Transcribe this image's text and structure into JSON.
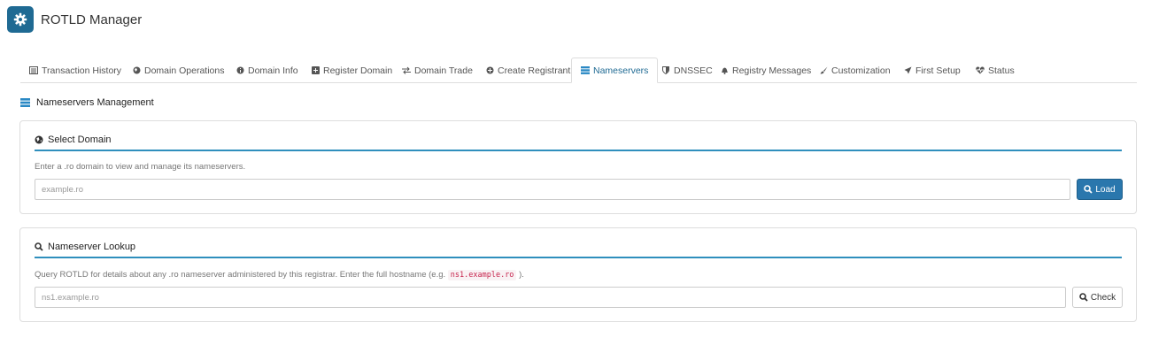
{
  "app": {
    "title": "ROTLD Manager",
    "icon": "gear-icon",
    "accent": "#1f6a93"
  },
  "tabs": [
    {
      "label": "Transaction History",
      "icon": "list-icon"
    },
    {
      "label": "Domain Operations",
      "icon": "globe-icon"
    },
    {
      "label": "Domain Info",
      "icon": "info-icon"
    },
    {
      "label": "Register Domain",
      "icon": "plus-square-icon"
    },
    {
      "label": "Domain Trade",
      "icon": "exchange-icon"
    },
    {
      "label": "Create Registrant",
      "icon": "plus-circle-icon"
    },
    {
      "label": "Nameservers",
      "icon": "server-icon",
      "active": true
    },
    {
      "label": "DNSSEC",
      "icon": "shield-icon"
    },
    {
      "label": "Registry Messages",
      "icon": "bell-icon"
    },
    {
      "label": "Customization",
      "icon": "brush-icon"
    },
    {
      "label": "First Setup",
      "icon": "rocket-icon"
    },
    {
      "label": "Status",
      "icon": "heartbeat-icon"
    }
  ],
  "section": {
    "title": "Nameservers Management",
    "icon": "server-icon"
  },
  "select_domain": {
    "title": "Select Domain",
    "icon": "globe-icon",
    "description": "Enter a .ro domain to view and manage its nameservers.",
    "placeholder": "example.ro",
    "value": "",
    "button_label": "Load",
    "button_icon": "search-icon"
  },
  "ns_lookup": {
    "title": "Nameserver Lookup",
    "icon": "search-icon",
    "description_before": "Query ROTLD for details about any .ro nameserver administered by this registrar. Enter the full hostname (e.g.",
    "description_code": "ns1.example.ro",
    "description_after": ").",
    "placeholder": "ns1.example.ro",
    "value": "",
    "button_label": "Check",
    "button_icon": "search-icon"
  }
}
